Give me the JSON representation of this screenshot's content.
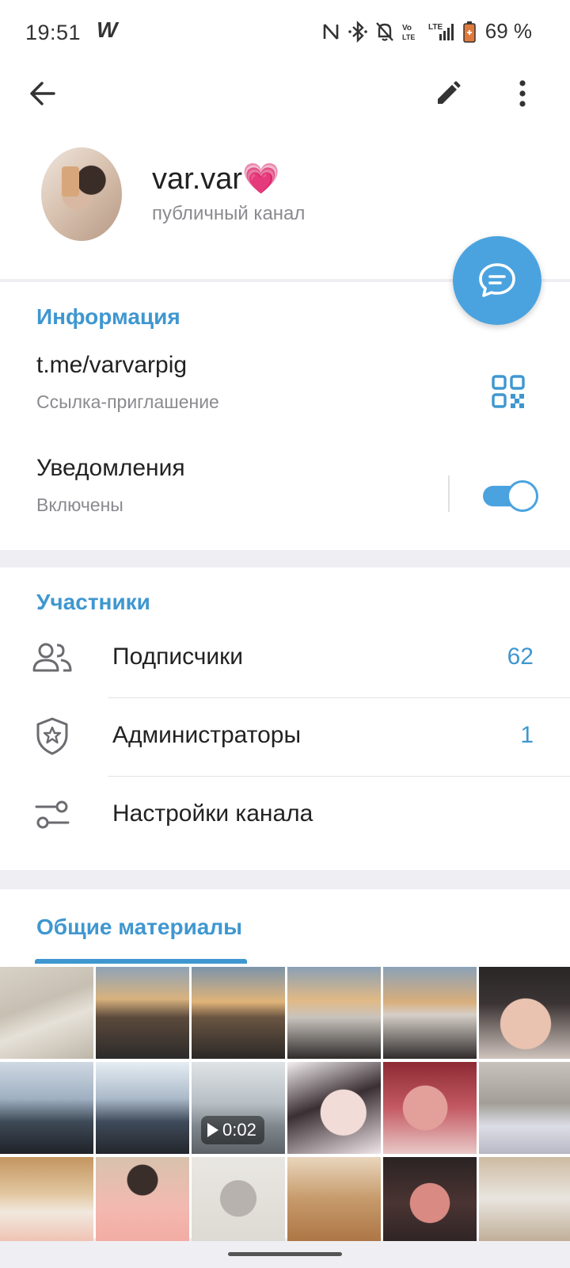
{
  "status_bar": {
    "time": "19:51",
    "app_glyph": "W",
    "battery": "69 %",
    "icons": [
      "nfc-icon",
      "bluetooth-icon",
      "notifications-off-icon",
      "volte-icon",
      "lte-signal-icon",
      "battery-saver-icon"
    ]
  },
  "app_bar": {
    "back_icon": "arrow-back-icon",
    "edit_icon": "pencil-icon",
    "menu_icon": "more-vert-icon"
  },
  "channel": {
    "name": "var.var💗",
    "subtitle": "публичный канал"
  },
  "fab": {
    "icon": "chat-bubble-icon"
  },
  "info": {
    "title": "Информация",
    "link": "t.me/varvarpig",
    "link_caption": "Ссылка-приглашение",
    "notifications_label": "Уведомления",
    "notifications_state": "Включены",
    "notifications_on": true
  },
  "members": {
    "title": "Участники",
    "rows": [
      {
        "label": "Подписчики",
        "count": "62",
        "icon": "people-icon"
      },
      {
        "label": "Администраторы",
        "count": "1",
        "icon": "shield-star-icon"
      },
      {
        "label": "Настройки канала",
        "count": "",
        "icon": "sliders-icon"
      }
    ]
  },
  "media": {
    "tab_title": "Общие материалы",
    "video_duration": "0:02"
  },
  "colors": {
    "accent": "#3f97d0",
    "fab": "#4aa3df",
    "background": "#efeef3"
  }
}
